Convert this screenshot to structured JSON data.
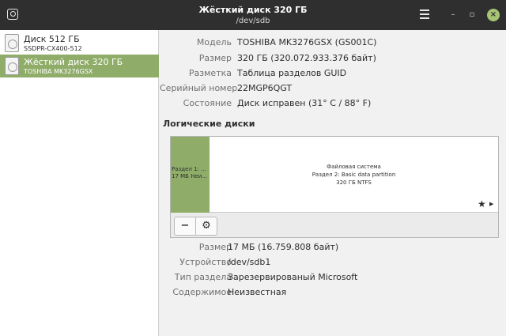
{
  "window": {
    "title": "Жёсткий диск 320 ГБ",
    "subtitle": "/dev/sdb",
    "app_icon": "disk-utility-icon",
    "menu_icon": "hamburger-menu-icon",
    "minimize_symbol": "–",
    "maximize_symbol": "▫",
    "close_symbol": "×",
    "accent": "#8fad69",
    "titlebar_color": "#2f2f2f"
  },
  "sidebar": {
    "disks": [
      {
        "name": "Диск 512 ГБ",
        "model": "SSDPR-CX400-512",
        "icon": "hard-disk-icon",
        "selected": false
      },
      {
        "name": "Жёсткий диск 320 ГБ",
        "model": "TOSHIBA MK3276GSX",
        "icon": "hard-disk-icon",
        "selected": true
      }
    ]
  },
  "drive": {
    "model_label": "Модель",
    "model_value": "TOSHIBA MK3276GSX (GS001C)",
    "size_label": "Размер",
    "size_value": "320 ГБ (320.072.933.376 байт)",
    "partitioning_label": "Разметка",
    "partitioning_value": "Таблица разделов GUID",
    "serial_label": "Серийный номер",
    "serial_value": "22MGP6QGT",
    "state_label": "Состояние",
    "state_value": "Диск исправен (31° C / 88° F)"
  },
  "volumes": {
    "section_title": "Логические диски",
    "partition1_line1": "Раздел 1: ...",
    "partition1_line2": "17 МБ Неи...",
    "partition2_line1": "Файловая система",
    "partition2_line2": "Раздел 2: Basic data partition",
    "partition2_line3": "320 ГБ NTFS",
    "star_symbol": "★",
    "arrow_symbol": "▶",
    "minus_symbol": "−",
    "gear_symbol": "⚙"
  },
  "partition": {
    "size_label": "Размер",
    "size_value": "17 МБ (16.759.808 байт)",
    "device_label": "Устройство",
    "device_value": "/dev/sdb1",
    "type_label": "Тип раздела",
    "type_value": "Зарезервированый Microsoft",
    "contents_label": "Содержимое",
    "contents_value": "Неизвестная"
  }
}
